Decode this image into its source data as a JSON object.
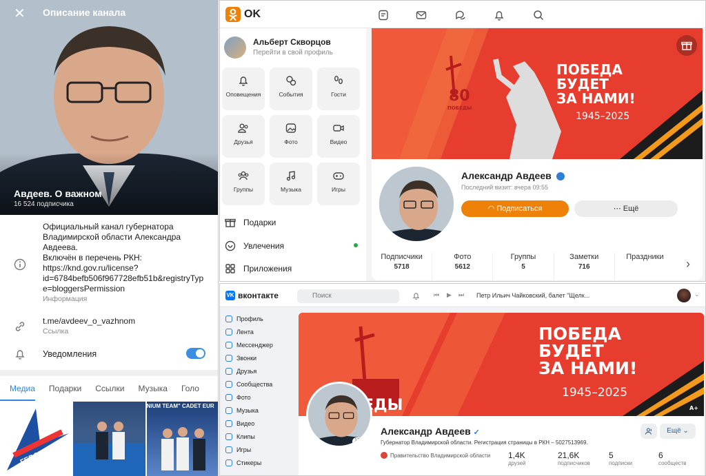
{
  "telegram": {
    "header_title": "Описание канала",
    "channel_name": "Авдеев. О важном",
    "subscribers": "16 524 подписчика",
    "description_lines": [
      "Официальный канал губернатора",
      "Владимирской области Александра",
      "Авдеева.",
      "Включён в перечень РКН:",
      "https://knd.gov.ru/license?",
      "id=6784befb506f967728efb51b&registryTyp",
      "e=bloggersPermission"
    ],
    "description_caption": "Информация",
    "link": "t.me/avdeev_o_vazhnom",
    "link_caption": "Ссылка",
    "notifications_label": "Уведомления",
    "notifications_on": true,
    "tabs": [
      "Медиа",
      "Подарки",
      "Ссылки",
      "Музыка",
      "Голо"
    ],
    "active_tab": "Медиа",
    "media_logo_text": "ГЕРОИ-33",
    "media_banner_text": "NIUM TEAM\" CADET EUR",
    "accent": "#3b8fe3"
  },
  "ok": {
    "brand": "OK",
    "user_name": "Альберт Скворцов",
    "user_sub": "Перейти в свой профиль",
    "tiles": [
      "Оповещения",
      "События",
      "Гости",
      "Друзья",
      "Фото",
      "Видео",
      "Группы",
      "Музыка",
      "Игры"
    ],
    "menu": [
      "Подарки",
      "Увлечения",
      "Приложения"
    ],
    "banner_line1": "ПОБЕДА",
    "banner_line2": "БУДЕТ",
    "banner_line3": "ЗА НАМИ!",
    "banner_years": "1945–2025",
    "banner_badge_num": "80",
    "banner_badge_word": "ПОБЕДЫ",
    "profile_name": "Александр Авдеев",
    "last_visit": "Последний визит: вчера 09:55",
    "subscribe_label": "Подписаться",
    "more_label": "Ещё",
    "stats": [
      {
        "label": "Подписчики",
        "value": "5718"
      },
      {
        "label": "Фото",
        "value": "5612"
      },
      {
        "label": "Группы",
        "value": "5"
      },
      {
        "label": "Заметки",
        "value": "716"
      },
      {
        "label": "Праздники",
        "value": ""
      }
    ],
    "accent": "#ee8208"
  },
  "vk": {
    "brand": "вконтакте",
    "search_placeholder": "Поиск",
    "now_playing": "Петр Ильич Чайковский, балет \"Щелк...",
    "menu": [
      "Профиль",
      "Лента",
      "Мессенджер",
      "Звонки",
      "Друзья",
      "Сообщества",
      "Фото",
      "Музыка",
      "Видео",
      "Клипы",
      "Игры",
      "Стикеры"
    ],
    "banner_line1": "ПОБЕДА",
    "banner_line2": "БУДЕТ",
    "banner_line3": "ЗА НАМИ!",
    "banner_years": "1945–2025",
    "banner_partial": "ЕДЫ",
    "age_badge": "А+",
    "profile_name": "Александр Авдеев",
    "status": "Губернатор Владимирской области. Регистрация страницы в РКН – 5027513969.",
    "org": "Правительство Владимирской области",
    "ava_badge": "13 мин",
    "more_label": "Ещё",
    "stats": [
      {
        "value": "1,4K",
        "label": "друзей"
      },
      {
        "value": "21,6K",
        "label": "подписчиков"
      },
      {
        "value": "5",
        "label": "подписки"
      },
      {
        "value": "6",
        "label": "сообществ"
      }
    ],
    "accent": "#0077ff"
  }
}
